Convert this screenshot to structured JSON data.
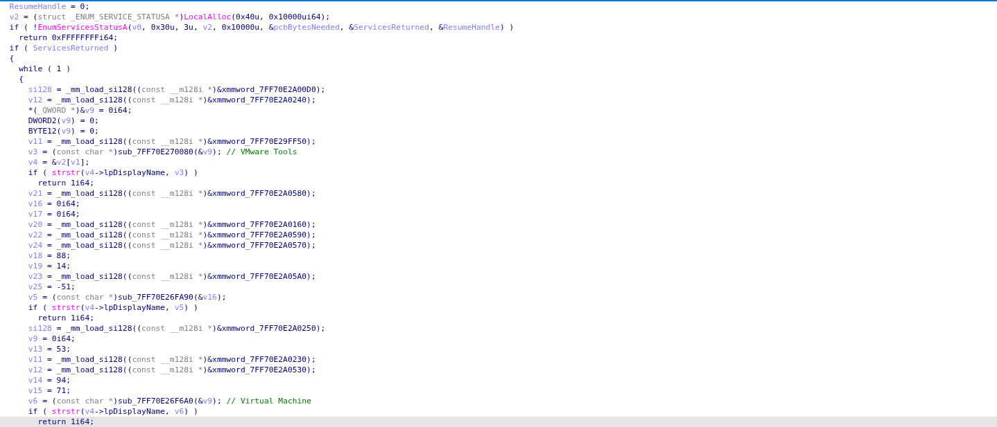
{
  "code_lines": [
    {
      "selected": false,
      "parts": [
        {
          "kind": "var",
          "text": "  ResumeHandle"
        },
        {
          "kind": "plain",
          "text": " = 0;"
        }
      ]
    },
    {
      "selected": false,
      "parts": [
        {
          "kind": "var",
          "text": "  v2"
        },
        {
          "kind": "plain",
          "text": " = ("
        },
        {
          "kind": "type",
          "text": "struct _ENUM_SERVICE_STATUSA *"
        },
        {
          "kind": "plain",
          "text": ")"
        },
        {
          "kind": "func",
          "text": "LocalAlloc"
        },
        {
          "kind": "plain",
          "text": "(0x40u, 0x10000ui64);"
        }
      ]
    },
    {
      "selected": false,
      "parts": [
        {
          "kind": "plain",
          "text": "  if ( !"
        },
        {
          "kind": "func",
          "text": "EnumServicesStatusA"
        },
        {
          "kind": "plain",
          "text": "("
        },
        {
          "kind": "var",
          "text": "v0"
        },
        {
          "kind": "plain",
          "text": ", 0x30u, 3u, "
        },
        {
          "kind": "var",
          "text": "v2"
        },
        {
          "kind": "plain",
          "text": ", 0x10000u, &"
        },
        {
          "kind": "var",
          "text": "pcbBytesNeeded"
        },
        {
          "kind": "plain",
          "text": ", &"
        },
        {
          "kind": "var",
          "text": "ServicesReturned"
        },
        {
          "kind": "plain",
          "text": ", &"
        },
        {
          "kind": "var",
          "text": "ResumeHandle"
        },
        {
          "kind": "plain",
          "text": ") )"
        }
      ]
    },
    {
      "selected": false,
      "parts": [
        {
          "kind": "plain",
          "text": "    return 0xFFFFFFFFi64;"
        }
      ]
    },
    {
      "selected": false,
      "parts": [
        {
          "kind": "plain",
          "text": "  if ( "
        },
        {
          "kind": "var",
          "text": "ServicesReturned"
        },
        {
          "kind": "plain",
          "text": " )"
        }
      ]
    },
    {
      "selected": false,
      "parts": [
        {
          "kind": "plain",
          "text": "  {"
        }
      ]
    },
    {
      "selected": false,
      "parts": [
        {
          "kind": "plain",
          "text": "    while ( 1 )"
        }
      ]
    },
    {
      "selected": false,
      "parts": [
        {
          "kind": "plain",
          "text": "    {"
        }
      ]
    },
    {
      "selected": false,
      "parts": [
        {
          "kind": "var",
          "text": "      si128"
        },
        {
          "kind": "plain",
          "text": " = _mm_load_si128(("
        },
        {
          "kind": "type",
          "text": "const __m128i *"
        },
        {
          "kind": "plain",
          "text": ")&xmmword_7FF70E2A00D0);"
        }
      ]
    },
    {
      "selected": false,
      "parts": [
        {
          "kind": "var",
          "text": "      v12"
        },
        {
          "kind": "plain",
          "text": " = _mm_load_si128(("
        },
        {
          "kind": "type",
          "text": "const __m128i *"
        },
        {
          "kind": "plain",
          "text": ")&xmmword_7FF70E2A0240);"
        }
      ]
    },
    {
      "selected": false,
      "parts": [
        {
          "kind": "plain",
          "text": "      *("
        },
        {
          "kind": "type",
          "text": "_QWORD *"
        },
        {
          "kind": "plain",
          "text": ")&"
        },
        {
          "kind": "var",
          "text": "v9"
        },
        {
          "kind": "plain",
          "text": " = 0i64;"
        }
      ]
    },
    {
      "selected": false,
      "parts": [
        {
          "kind": "plain",
          "text": "      DWORD2("
        },
        {
          "kind": "var",
          "text": "v9"
        },
        {
          "kind": "plain",
          "text": ") = 0;"
        }
      ]
    },
    {
      "selected": false,
      "parts": [
        {
          "kind": "plain",
          "text": "      BYTE12("
        },
        {
          "kind": "var",
          "text": "v9"
        },
        {
          "kind": "plain",
          "text": ") = 0;"
        }
      ]
    },
    {
      "selected": false,
      "parts": [
        {
          "kind": "var",
          "text": "      v11"
        },
        {
          "kind": "plain",
          "text": " = _mm_load_si128(("
        },
        {
          "kind": "type",
          "text": "const __m128i *"
        },
        {
          "kind": "plain",
          "text": ")&xmmword_7FF70E29FF50);"
        }
      ]
    },
    {
      "selected": false,
      "parts": [
        {
          "kind": "var",
          "text": "      v3"
        },
        {
          "kind": "plain",
          "text": " = ("
        },
        {
          "kind": "type",
          "text": "const char *"
        },
        {
          "kind": "plain",
          "text": ")sub_7FF70E270080(&"
        },
        {
          "kind": "var",
          "text": "v9"
        },
        {
          "kind": "plain",
          "text": "); "
        },
        {
          "kind": "comment",
          "text": "// VMware Tools"
        }
      ]
    },
    {
      "selected": false,
      "parts": [
        {
          "kind": "var",
          "text": "      v4"
        },
        {
          "kind": "plain",
          "text": " = &"
        },
        {
          "kind": "var",
          "text": "v2"
        },
        {
          "kind": "plain",
          "text": "["
        },
        {
          "kind": "var",
          "text": "v1"
        },
        {
          "kind": "plain",
          "text": "];"
        }
      ]
    },
    {
      "selected": false,
      "parts": [
        {
          "kind": "plain",
          "text": "      if ( "
        },
        {
          "kind": "func",
          "text": "strstr"
        },
        {
          "kind": "plain",
          "text": "("
        },
        {
          "kind": "var",
          "text": "v4"
        },
        {
          "kind": "plain",
          "text": "->lpDisplayName, "
        },
        {
          "kind": "var",
          "text": "v3"
        },
        {
          "kind": "plain",
          "text": ") )"
        }
      ]
    },
    {
      "selected": false,
      "parts": [
        {
          "kind": "plain",
          "text": "        return 1i64;"
        }
      ]
    },
    {
      "selected": false,
      "parts": [
        {
          "kind": "var",
          "text": "      v21"
        },
        {
          "kind": "plain",
          "text": " = _mm_load_si128(("
        },
        {
          "kind": "type",
          "text": "const __m128i *"
        },
        {
          "kind": "plain",
          "text": ")&xmmword_7FF70E2A0580);"
        }
      ]
    },
    {
      "selected": false,
      "parts": [
        {
          "kind": "var",
          "text": "      v16"
        },
        {
          "kind": "plain",
          "text": " = 0i64;"
        }
      ]
    },
    {
      "selected": false,
      "parts": [
        {
          "kind": "var",
          "text": "      v17"
        },
        {
          "kind": "plain",
          "text": " = 0i64;"
        }
      ]
    },
    {
      "selected": false,
      "parts": [
        {
          "kind": "var",
          "text": "      v20"
        },
        {
          "kind": "plain",
          "text": " = _mm_load_si128(("
        },
        {
          "kind": "type",
          "text": "const __m128i *"
        },
        {
          "kind": "plain",
          "text": ")&xmmword_7FF70E2A0160);"
        }
      ]
    },
    {
      "selected": false,
      "parts": [
        {
          "kind": "var",
          "text": "      v22"
        },
        {
          "kind": "plain",
          "text": " = _mm_load_si128(("
        },
        {
          "kind": "type",
          "text": "const __m128i *"
        },
        {
          "kind": "plain",
          "text": ")&xmmword_7FF70E2A0590);"
        }
      ]
    },
    {
      "selected": false,
      "parts": [
        {
          "kind": "var",
          "text": "      v24"
        },
        {
          "kind": "plain",
          "text": " = _mm_load_si128(("
        },
        {
          "kind": "type",
          "text": "const __m128i *"
        },
        {
          "kind": "plain",
          "text": ")&xmmword_7FF70E2A0570);"
        }
      ]
    },
    {
      "selected": false,
      "parts": [
        {
          "kind": "var",
          "text": "      v18"
        },
        {
          "kind": "plain",
          "text": " = 88;"
        }
      ]
    },
    {
      "selected": false,
      "parts": [
        {
          "kind": "var",
          "text": "      v19"
        },
        {
          "kind": "plain",
          "text": " = 14;"
        }
      ]
    },
    {
      "selected": false,
      "parts": [
        {
          "kind": "var",
          "text": "      v23"
        },
        {
          "kind": "plain",
          "text": " = _mm_load_si128(("
        },
        {
          "kind": "type",
          "text": "const __m128i *"
        },
        {
          "kind": "plain",
          "text": ")&xmmword_7FF70E2A05A0);"
        }
      ]
    },
    {
      "selected": false,
      "parts": [
        {
          "kind": "var",
          "text": "      v25"
        },
        {
          "kind": "plain",
          "text": " = -51;"
        }
      ]
    },
    {
      "selected": false,
      "parts": [
        {
          "kind": "var",
          "text": "      v5"
        },
        {
          "kind": "plain",
          "text": " = ("
        },
        {
          "kind": "type",
          "text": "const char *"
        },
        {
          "kind": "plain",
          "text": ")sub_7FF70E26FA90(&"
        },
        {
          "kind": "var",
          "text": "v16"
        },
        {
          "kind": "plain",
          "text": ");"
        }
      ]
    },
    {
      "selected": false,
      "parts": [
        {
          "kind": "plain",
          "text": "      if ( "
        },
        {
          "kind": "func",
          "text": "strstr"
        },
        {
          "kind": "plain",
          "text": "("
        },
        {
          "kind": "var",
          "text": "v4"
        },
        {
          "kind": "plain",
          "text": "->lpDisplayName, "
        },
        {
          "kind": "var",
          "text": "v5"
        },
        {
          "kind": "plain",
          "text": ") )"
        }
      ]
    },
    {
      "selected": false,
      "parts": [
        {
          "kind": "plain",
          "text": "        return 1i64;"
        }
      ]
    },
    {
      "selected": false,
      "parts": [
        {
          "kind": "var",
          "text": "      si128"
        },
        {
          "kind": "plain",
          "text": " = _mm_load_si128(("
        },
        {
          "kind": "type",
          "text": "const __m128i *"
        },
        {
          "kind": "plain",
          "text": ")&xmmword_7FF70E2A0250);"
        }
      ]
    },
    {
      "selected": false,
      "parts": [
        {
          "kind": "var",
          "text": "      v9"
        },
        {
          "kind": "plain",
          "text": " = 0i64;"
        }
      ]
    },
    {
      "selected": false,
      "parts": [
        {
          "kind": "var",
          "text": "      v13"
        },
        {
          "kind": "plain",
          "text": " = 53;"
        }
      ]
    },
    {
      "selected": false,
      "parts": [
        {
          "kind": "var",
          "text": "      v11"
        },
        {
          "kind": "plain",
          "text": " = _mm_load_si128(("
        },
        {
          "kind": "type",
          "text": "const __m128i *"
        },
        {
          "kind": "plain",
          "text": ")&xmmword_7FF70E2A0230);"
        }
      ]
    },
    {
      "selected": false,
      "parts": [
        {
          "kind": "var",
          "text": "      v12"
        },
        {
          "kind": "plain",
          "text": " = _mm_load_si128(("
        },
        {
          "kind": "type",
          "text": "const __m128i *"
        },
        {
          "kind": "plain",
          "text": ")&xmmword_7FF70E2A0530);"
        }
      ]
    },
    {
      "selected": false,
      "parts": [
        {
          "kind": "var",
          "text": "      v14"
        },
        {
          "kind": "plain",
          "text": " = 94;"
        }
      ]
    },
    {
      "selected": false,
      "parts": [
        {
          "kind": "var",
          "text": "      v15"
        },
        {
          "kind": "plain",
          "text": " = 71;"
        }
      ]
    },
    {
      "selected": false,
      "parts": [
        {
          "kind": "var",
          "text": "      v6"
        },
        {
          "kind": "plain",
          "text": " = ("
        },
        {
          "kind": "type",
          "text": "const char *"
        },
        {
          "kind": "plain",
          "text": ")sub_7FF70E26F6A0(&"
        },
        {
          "kind": "var",
          "text": "v9"
        },
        {
          "kind": "plain",
          "text": "); "
        },
        {
          "kind": "comment",
          "text": "// Virtual Machine"
        }
      ]
    },
    {
      "selected": false,
      "parts": [
        {
          "kind": "plain",
          "text": "      if ( "
        },
        {
          "kind": "func",
          "text": "strstr"
        },
        {
          "kind": "plain",
          "text": "("
        },
        {
          "kind": "var",
          "text": "v4"
        },
        {
          "kind": "plain",
          "text": "->lpDisplayName, "
        },
        {
          "kind": "var",
          "text": "v6"
        },
        {
          "kind": "plain",
          "text": ") )"
        }
      ]
    },
    {
      "selected": true,
      "parts": [
        {
          "kind": "plain",
          "text": "        return 1i64;"
        }
      ]
    }
  ]
}
